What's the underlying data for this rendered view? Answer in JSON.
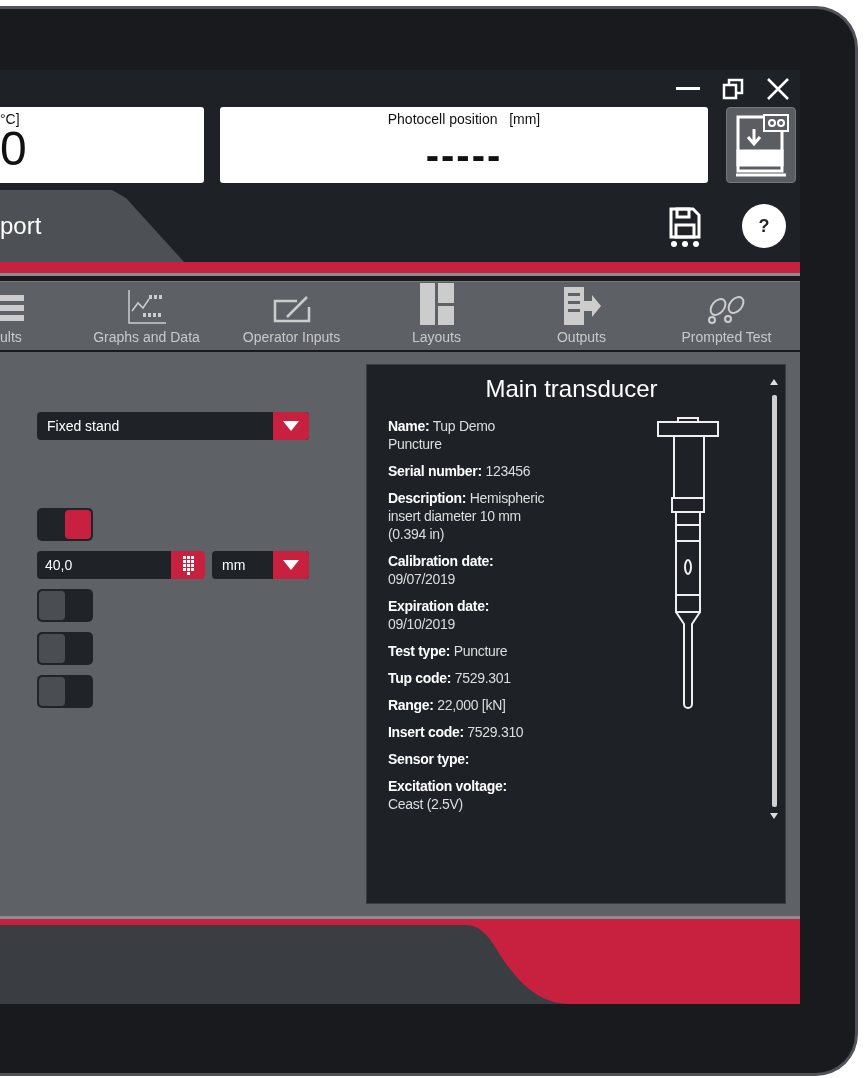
{
  "readouts": [
    {
      "label": "°C]",
      "value": "0"
    },
    {
      "label": "Photocell position   [mm]",
      "value": "-----"
    }
  ],
  "tab": {
    "label": "port",
    "selected": true
  },
  "help_button": "?",
  "toolbar": [
    {
      "label": "ults"
    },
    {
      "label": "Graphs and Data"
    },
    {
      "label": "Operator Inputs"
    },
    {
      "label": "Layouts"
    },
    {
      "label": "Outputs"
    },
    {
      "label": "Prompted Test"
    }
  ],
  "form": [
    {
      "kind": "select",
      "value": "Fixed stand"
    },
    {
      "kind": "toggle",
      "on": true
    },
    {
      "kind": "number",
      "value": "40,0",
      "unit": "mm"
    },
    {
      "kind": "toggle",
      "on": false
    },
    {
      "kind": "toggle",
      "on": false
    },
    {
      "kind": "toggle",
      "on": false
    }
  ],
  "panel": {
    "title": "Main transducer",
    "fields": [
      "**Name:**  Tup Demo\nPuncture",
      "**Serial number:**  123456",
      "**Description:**  Hemispheric\ninsert diameter 10 mm\n(0.394 in)",
      "**Calibration date:**\n09/07/2019",
      "**Expiration date:**\n09/10/2019",
      "**Test type:**  Puncture",
      "**Tup code:**  7529.301",
      "**Range:**  22,000 [kN]",
      "**Insert code:**  7529.310",
      "**Sensor type:**",
      "**Excitation voltage:**\nCeast (2.5V)"
    ]
  }
}
